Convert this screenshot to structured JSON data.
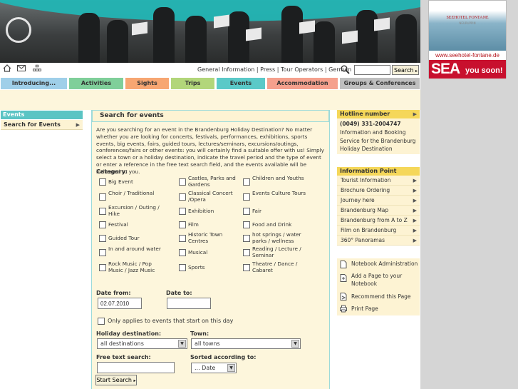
{
  "toolbar": {
    "links": [
      "General Information",
      "Press",
      "Tour Operators",
      "German"
    ],
    "separator": " | ",
    "search_value": "",
    "search_button": "Search"
  },
  "ad": {
    "brand": "SEEHOTEL FONTANE",
    "sub": "NEURUPPIN",
    "url": "www.seehotel-fontane.de",
    "big": "SEA",
    "soon": "you soon!"
  },
  "nav": {
    "tabs": [
      {
        "label": "Introducing...",
        "color": "#9fcfe9"
      },
      {
        "label": "Activities",
        "color": "#7fcf9a"
      },
      {
        "label": "Sights",
        "color": "#f7a672"
      },
      {
        "label": "Trips",
        "color": "#b2d67a"
      },
      {
        "label": "Events",
        "color": "#5ac9c8"
      },
      {
        "label": "Accommodation",
        "color": "#f5a08d"
      },
      {
        "label": "Groups & Conferences",
        "color": "#bfbfbf"
      }
    ]
  },
  "left_nav": {
    "section": "Events",
    "items": [
      "Search for Events"
    ]
  },
  "main": {
    "title": "Search for events",
    "intro": "Are you searching for an event in the Brandenburg Holiday Destination? No matter whether you are looking for concerts, festivals, performances, exhibitions, sports events, big events, fairs, guided tours, lectures/seminars, excursions/outings, conferences/fairs or other events: you will certainly find a suitable offer with us! Simply select a town or a holiday destination, indicate the travel period and the type of event or enter a reference in the free text search field, and the events available will be indicated to you.",
    "category_label": "Category:",
    "categories": [
      [
        "Big Event",
        "Castles, Parks and Gardens",
        "Children and Youths"
      ],
      [
        "Choir / Traditional",
        "Classical Concert /Opera",
        "Events Culture Tours"
      ],
      [
        "Excursion / Outing / Hike",
        "Exhibition",
        "Fair"
      ],
      [
        "Festival",
        "Film",
        "Food and Drink"
      ],
      [
        "Guided Tour",
        "Historic Town Centres",
        "hot springs / water parks / wellness"
      ],
      [
        "In and around water",
        "Musical",
        "Reading / Lecture / Seminar"
      ],
      [
        "Rock Music / Pop Music / Jazz Music",
        "Sports",
        "Theatre / Dance / Cabaret"
      ]
    ],
    "date_from_label": "Date from:",
    "date_from_value": "02.07.2010",
    "date_to_label": "Date to:",
    "date_to_value": "",
    "only_start_label": "Only applies to events that start on this day",
    "holiday_label": "Holiday destination:",
    "holiday_value": "all destinations",
    "town_label": "Town:",
    "town_value": "all towns",
    "free_text_label": "Free text search:",
    "free_text_value": "",
    "sorted_label": "Sorted according to:",
    "sorted_value": "... Date",
    "start_button": "Start Search"
  },
  "hotline": {
    "title": "Hotline number",
    "number": "(0049) 331-2004747",
    "line1": "Information and Booking",
    "line2": "Service for the Brandenburg",
    "line3": "Holiday Destination"
  },
  "info_point": {
    "title": "Information Point",
    "items": [
      "Tourist Information",
      "Brochure Ordering",
      "Journey here",
      "Brandenburg Map",
      "Brandenburg from A to Z",
      "Film on Brandenburg",
      "360° Panoramas"
    ]
  },
  "tools": {
    "items": [
      "Notebook Administration",
      "Add a Page to your Notebook",
      "Recommend this Page",
      "Print Page"
    ]
  }
}
